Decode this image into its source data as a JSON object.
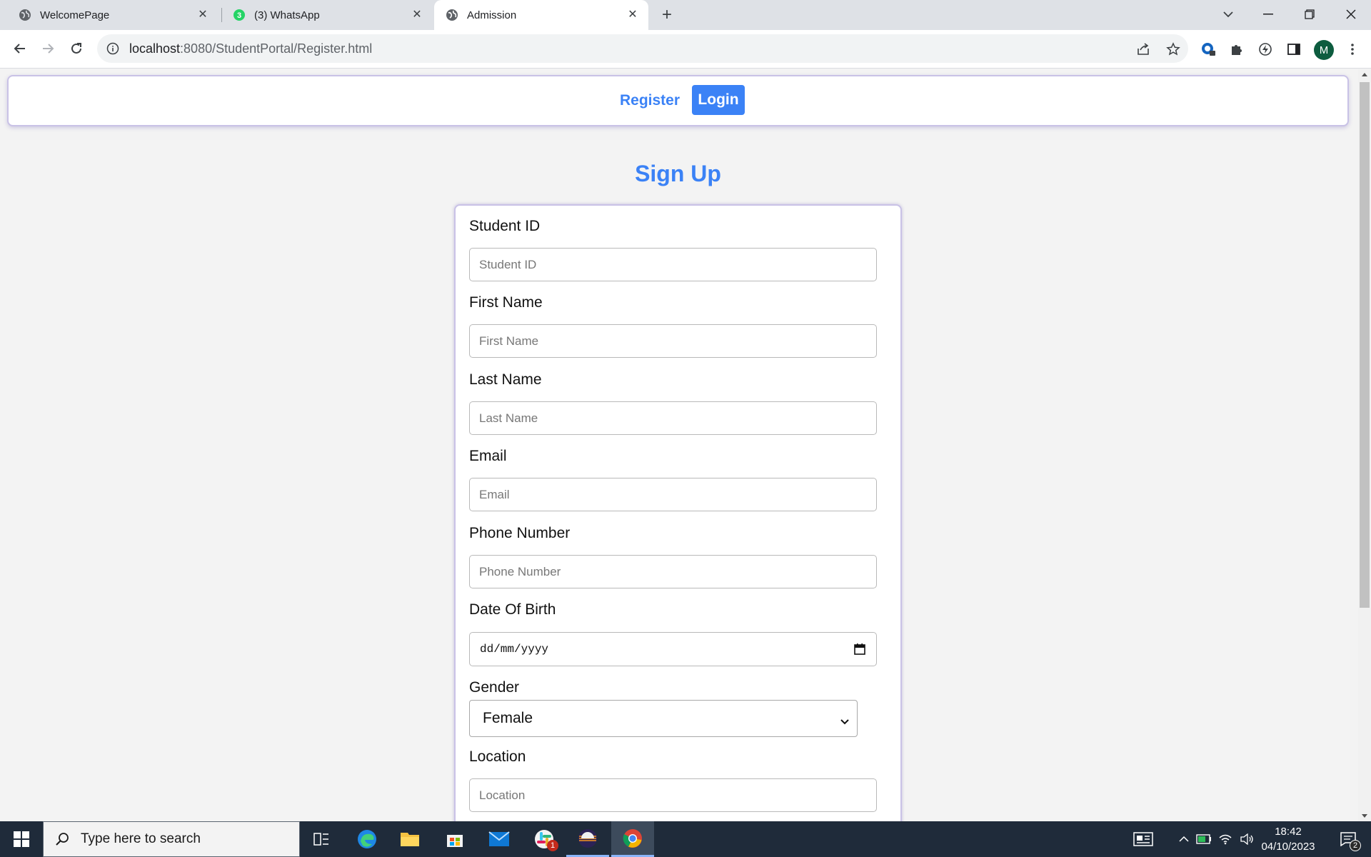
{
  "browser": {
    "tabs": [
      {
        "title": "WelcomePage",
        "active": false,
        "icon": "globe-icon"
      },
      {
        "title": "(3) WhatsApp",
        "active": false,
        "icon": "whatsapp-icon",
        "badge": "3"
      },
      {
        "title": "Admission",
        "active": true,
        "icon": "globe-icon"
      }
    ],
    "url_host": "localhost",
    "url_rest": ":8080/StudentPortal/Register.html",
    "profile_initial": "M"
  },
  "navbar": {
    "register_label": "Register",
    "login_label": "Login"
  },
  "page": {
    "title": "Sign Up"
  },
  "form": {
    "student_id": {
      "label": "Student ID",
      "placeholder": "Student ID"
    },
    "first_name": {
      "label": "First Name",
      "placeholder": "First Name"
    },
    "last_name": {
      "label": "Last Name",
      "placeholder": "Last Name"
    },
    "email": {
      "label": "Email",
      "placeholder": "Email"
    },
    "phone": {
      "label": "Phone Number",
      "placeholder": "Phone Number"
    },
    "dob": {
      "label": "Date Of Birth",
      "value": "dd/mm/yyyy"
    },
    "gender": {
      "label": "Gender",
      "value": "Female"
    },
    "location": {
      "label": "Location",
      "placeholder": "Location"
    }
  },
  "taskbar": {
    "search_placeholder": "Type here to search",
    "time": "18:42",
    "date": "04/10/2023",
    "slack_badge": "1",
    "notification_count": "2"
  },
  "colors": {
    "accent": "#3b82f6",
    "card_border": "#c9c2e6",
    "taskbar": "#1f2b3a"
  }
}
